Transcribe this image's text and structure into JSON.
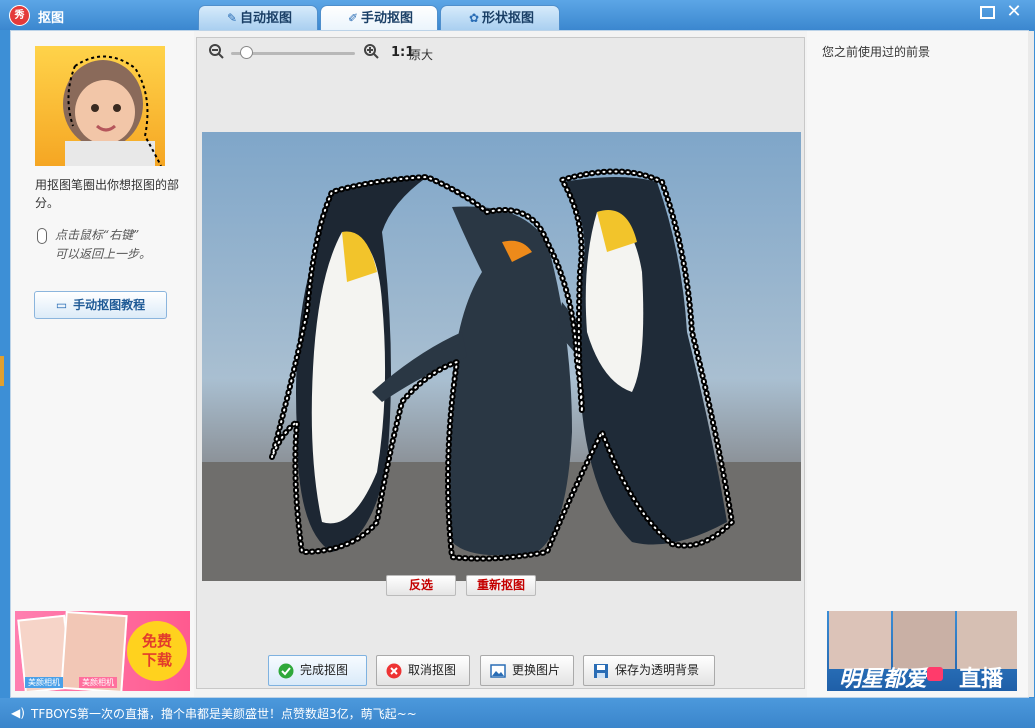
{
  "window": {
    "title": "抠图",
    "logo_text": "秀",
    "accent": "#3b87cf"
  },
  "tabs": [
    {
      "label": "自动抠图",
      "icon": "brush-icon",
      "active": false
    },
    {
      "label": "手动抠图",
      "icon": "pen-icon",
      "active": true
    },
    {
      "label": "形状抠图",
      "icon": "shape-icon",
      "active": false
    }
  ],
  "left": {
    "hint": "用抠图笔圈出你想抠图的部分。",
    "hint2_line1": "点击鼠标“右键”",
    "hint2_line2": "可以返回上一步。",
    "tutorial_button": "手动抠图教程",
    "ad": {
      "tag1": "美颜相机",
      "tag2": "美颜相机",
      "free_line1": "免费",
      "free_line2": "下载"
    }
  },
  "editor": {
    "zoom_ratio": "1:1",
    "zoom_label": "原大",
    "invert_button": "反选",
    "redo_button": "重新抠图"
  },
  "actions": [
    {
      "label": "完成抠图",
      "icon": "check-icon",
      "color": "#2fa83a"
    },
    {
      "label": "取消抠图",
      "icon": "cancel-icon",
      "color": "#e33"
    },
    {
      "label": "更换图片",
      "icon": "image-icon",
      "color": "#2a6db5"
    },
    {
      "label": "保存为透明背景",
      "icon": "save-icon",
      "color": "#2a6db5"
    }
  ],
  "right": {
    "recent_backgrounds": "您之前使用过的前景",
    "ad": {
      "left_text": "明星都爱",
      "right_text": "直播"
    }
  },
  "status": {
    "text": "TFBOYS第一次の直播，撸个串都是美颜盛世！点赞数超3亿，萌飞起~~"
  }
}
